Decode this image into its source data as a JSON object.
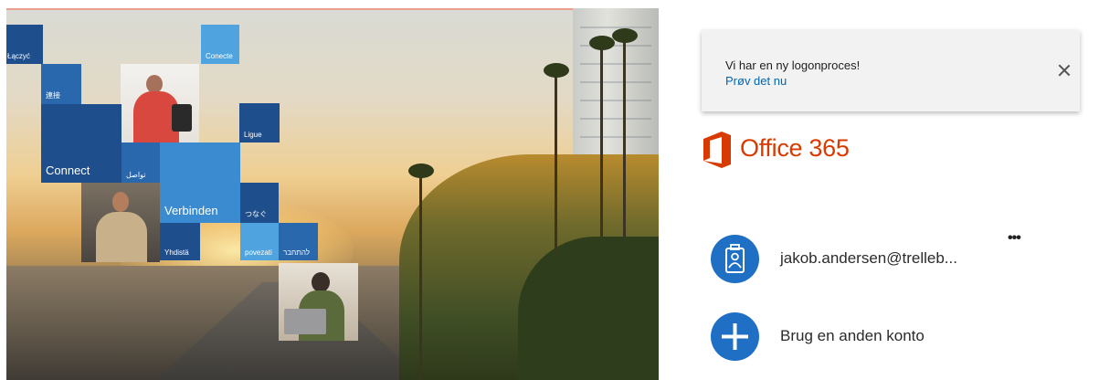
{
  "tiles": {
    "laczyc": "Łączyć",
    "conecte": "Conecte",
    "renraku": "連接",
    "connect": "Connect",
    "tawasal": "تواصل",
    "ligue": "Ligue",
    "verbinden": "Verbinden",
    "tsunagu": "つなぐ",
    "yhdista": "Yhdistä",
    "povezati": "povezati",
    "lehitchaber": "להתחבר"
  },
  "notice": {
    "message": "Vi har en ny logonproces!",
    "link": "Prøv det nu"
  },
  "brand": {
    "name": "Office 365",
    "color": "#d83b01"
  },
  "accounts": [
    {
      "label": "jakob.andersen@trelleb...",
      "icon": "badge-icon"
    },
    {
      "label": "Brug en anden konto",
      "icon": "plus-icon"
    }
  ],
  "more_options_label": "•••",
  "colors": {
    "accent_blue": "#1f6fc5",
    "link_blue": "#0067b8"
  }
}
